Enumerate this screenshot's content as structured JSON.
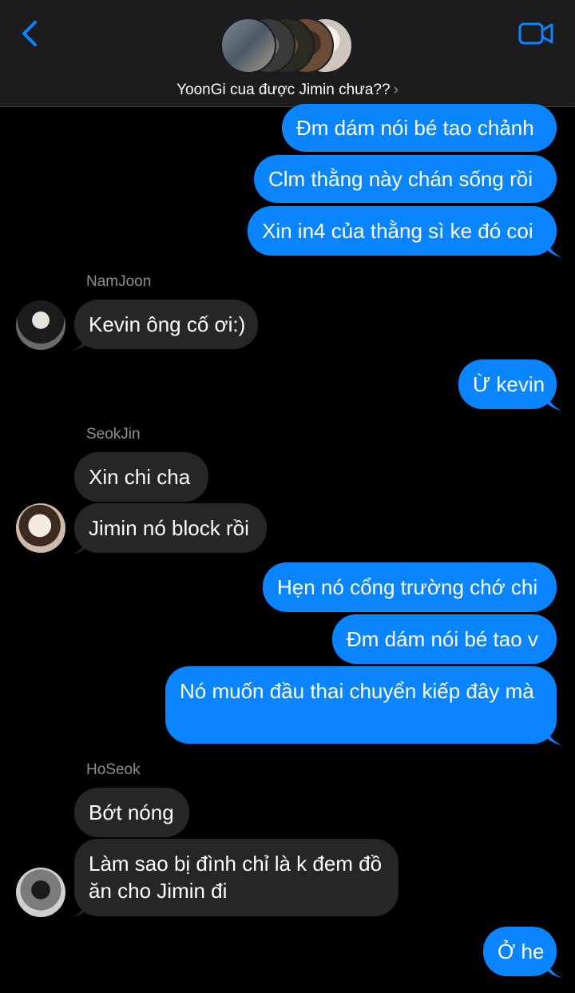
{
  "header": {
    "title": "YoonGi cua được Jimin chưa??",
    "chevron": "›",
    "back_icon": "chevron-left-icon",
    "video_icon": "video-camera-icon",
    "accent": "#0a84ff"
  },
  "messages": [
    {
      "dir": "out",
      "text": "Đm dám nói bé tao chảnh"
    },
    {
      "dir": "out",
      "text": "Clm thằng này chán sống rồi"
    },
    {
      "dir": "out",
      "text": "Xin in4 của thằng sì ke đó coi"
    },
    {
      "dir": "in",
      "sender": "NamJoon",
      "text": "Kevin ông cố ơi:)"
    },
    {
      "dir": "out",
      "text": "Ừ kevin"
    },
    {
      "dir": "in",
      "sender": "SeokJin",
      "text": "Xin chi cha"
    },
    {
      "dir": "in",
      "text": "Jimin nó block rồi"
    },
    {
      "dir": "out",
      "text": "Hẹn nó cổng trường chớ chi"
    },
    {
      "dir": "out",
      "text": "Đm dám nói bé tao v"
    },
    {
      "dir": "out",
      "text": "Nó muốn đầu thai chuyển kiếp đây mà"
    },
    {
      "dir": "in",
      "sender": "HoSeok",
      "text": "Bớt nóng"
    },
    {
      "dir": "in",
      "text": "Làm sao bị đình chỉ là k đem đồ ăn cho Jimin đi"
    },
    {
      "dir": "out",
      "text": "Ở he"
    }
  ],
  "colors": {
    "outgoing_bubble": "#0a84ff",
    "incoming_bubble": "#262628",
    "background": "#000000"
  }
}
